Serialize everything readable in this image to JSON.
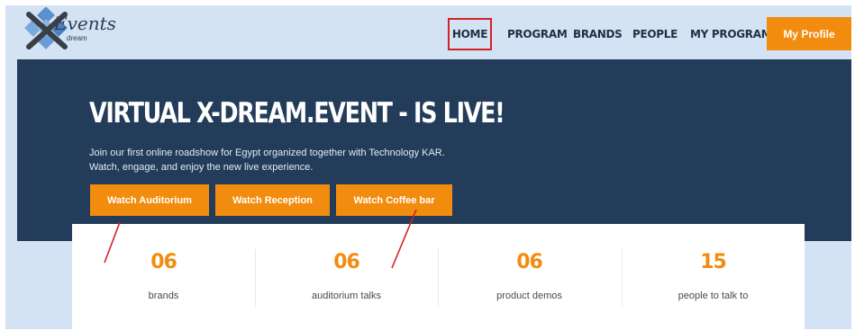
{
  "brand": {
    "logo_text": "Events",
    "logo_sub": "dream"
  },
  "nav": {
    "items": [
      {
        "label": "HOME"
      },
      {
        "label": "PROGRAM"
      },
      {
        "label": "BRANDS"
      },
      {
        "label": "PEOPLE"
      },
      {
        "label": "MY PROGRAM"
      }
    ],
    "profile_label": "My Profile"
  },
  "hero": {
    "title": "VIRTUAL X-DREAM.EVENT - IS LIVE!",
    "desc_line1": "Join our first online roadshow for Egypt organized together with Technology KAR.",
    "desc_line2": "Watch, engage, and enjoy the new live experience.",
    "buttons": [
      {
        "label": "Watch Auditorium"
      },
      {
        "label": "Watch Reception"
      },
      {
        "label": "Watch Coffee bar"
      }
    ]
  },
  "stats": [
    {
      "value": "06",
      "label": "brands"
    },
    {
      "value": "06",
      "label": "auditorium talks"
    },
    {
      "value": "06",
      "label": "product demos"
    },
    {
      "value": "15",
      "label": "people to talk to"
    }
  ],
  "colors": {
    "accent": "#f28c0f",
    "hero_bg": "#223c5a",
    "page_bg": "#d3e3f3",
    "highlight": "#d62027"
  }
}
